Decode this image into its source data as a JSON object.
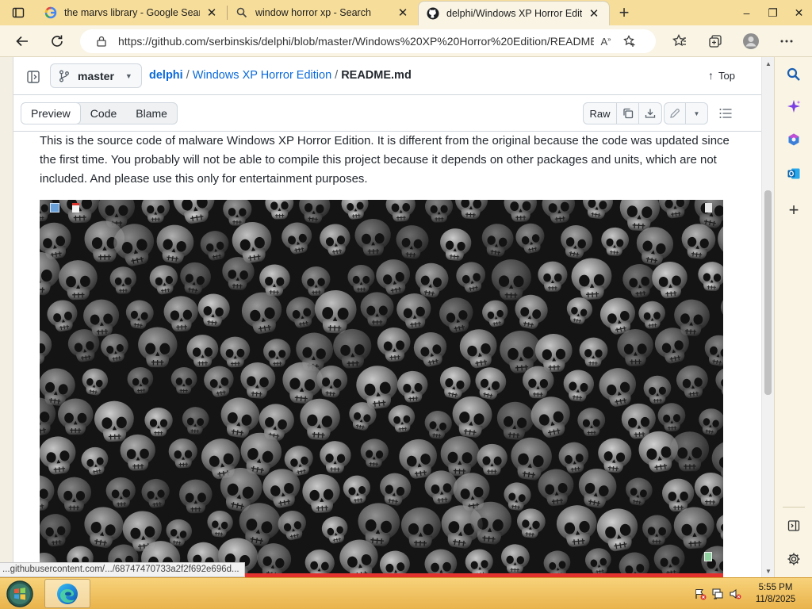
{
  "browser": {
    "tabs": [
      {
        "title": "the marvs library - Google Search",
        "favicon": "google-icon",
        "active": false
      },
      {
        "title": "window horror xp - Search",
        "favicon": "search-icon",
        "active": false
      },
      {
        "title": "delphi/Windows XP Horror Edition",
        "favicon": "github-icon",
        "active": true
      }
    ],
    "window_controls": {
      "minimize": "–",
      "restore": "❐",
      "close": "✕"
    },
    "url": "https://github.com/serbinskis/delphi/blob/master/Windows%20XP%20Horror%20Edition/README..."
  },
  "repo_header": {
    "branch": "master",
    "breadcrumb": {
      "repo": "delphi",
      "folder": "Windows XP Horror Edition",
      "file": "README.md",
      "separator": "/"
    },
    "top_label": "Top"
  },
  "file_toolbar": {
    "views": [
      "Preview",
      "Code",
      "Blame"
    ],
    "active_view": "Preview",
    "raw_label": "Raw"
  },
  "readme": {
    "paragraph": "This is the source code of malware Windows XP Horror Edition. It is different from the original because the code was updated since the first time. You probably will not be able to compile this project because it depends on other packages and units, which are not included. And please use this only for entertainment purposes."
  },
  "status_url": "...githubusercontent.com/.../68747470733a2f2f692e696d...",
  "taskbar": {
    "clock_time": "5:55 PM",
    "clock_date": "11/8/2025"
  },
  "colors": {
    "link": "#0969da",
    "tab_strip": "#f6dd9a",
    "taskbar": "#e9b34c",
    "accent_red": "#e3312d"
  }
}
